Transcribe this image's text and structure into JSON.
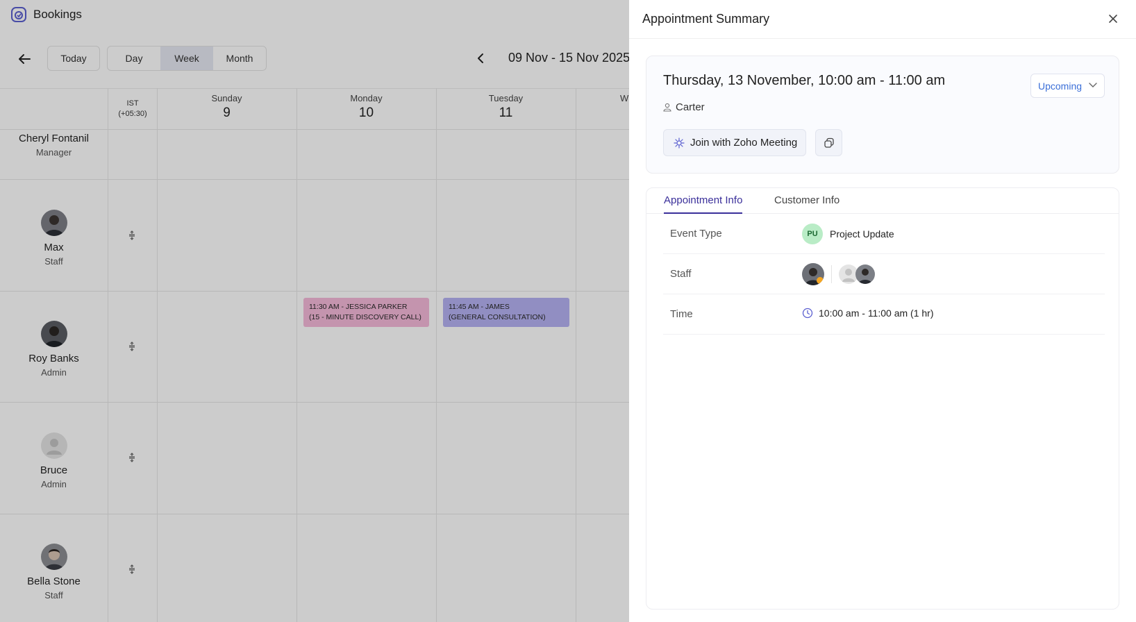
{
  "app": {
    "title": "Bookings"
  },
  "toolbar": {
    "today_label": "Today",
    "views": [
      {
        "label": "Day",
        "active": false
      },
      {
        "label": "Week",
        "active": true
      },
      {
        "label": "Month",
        "active": false
      }
    ],
    "date_range": "09 Nov - 15 Nov 2025"
  },
  "calendar": {
    "timezone_line1": "IST",
    "timezone_line2": "(+05:30)",
    "days": [
      {
        "name": "Sunday",
        "num": "9"
      },
      {
        "name": "Monday",
        "num": "10"
      },
      {
        "name": "Tuesday",
        "num": "11"
      },
      {
        "name": "W",
        "num": ""
      }
    ],
    "staff": [
      {
        "name": "Cheryl Fontanil",
        "role": "Manager"
      },
      {
        "name": "Max",
        "role": "Staff"
      },
      {
        "name": "Roy Banks",
        "role": "Admin"
      },
      {
        "name": "Bruce",
        "role": "Admin"
      },
      {
        "name": "Bella Stone",
        "role": "Staff"
      }
    ],
    "events": [
      {
        "line1": "11:30 AM - JESSICA PARKER",
        "line2": "(15 - MINUTE DISCOVERY CALL)",
        "color": "#f6b9da"
      },
      {
        "line1": "11:45 AM - JAMES",
        "line2": "(GENERAL CONSULTATION)",
        "color": "#b6b2f3"
      }
    ]
  },
  "panel": {
    "title": "Appointment Summary",
    "when": "Thursday, 13 November, 10:00 am - 11:00 am",
    "status": "Upcoming",
    "customer": "Carter",
    "join_label": "Join with Zoho Meeting",
    "tabs": [
      {
        "label": "Appointment Info",
        "active": true
      },
      {
        "label": "Customer Info",
        "active": false
      }
    ],
    "info": {
      "event_type_label": "Event Type",
      "event_type_badge": "PU",
      "event_type_value": "Project Update",
      "staff_label": "Staff",
      "time_label": "Time",
      "time_value": "10:00 am - 11:00 am (1 hr)"
    }
  },
  "colors": {
    "accent": "#3a2f9a",
    "status": "#3b6fd8",
    "event_pink": "#f6b9da",
    "event_purple": "#b6b2f3",
    "badge_green": "#b9ecc6"
  }
}
